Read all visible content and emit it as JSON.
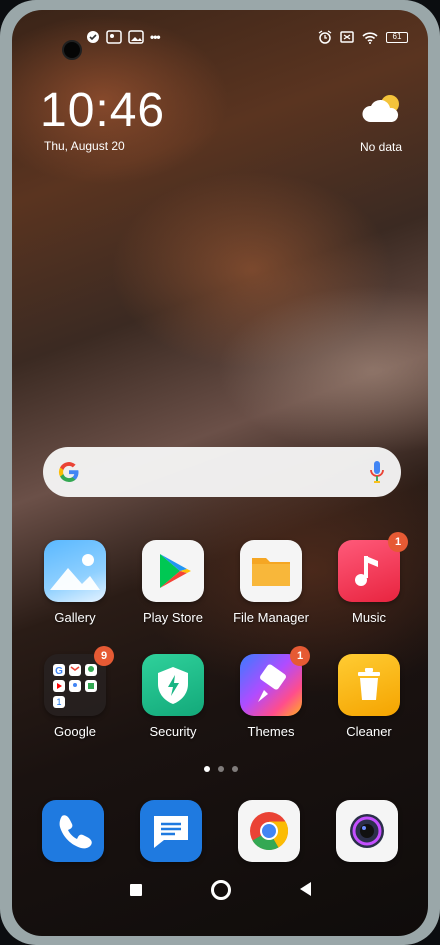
{
  "status_bar": {
    "left_icons": [
      "checkmark-shield-icon",
      "photo-icon",
      "image-icon"
    ],
    "more": "•••",
    "right_icons": [
      "alarm-icon",
      "close-box-icon",
      "wifi-icon"
    ],
    "battery": "61"
  },
  "clock": {
    "time": "10:46",
    "date": "Thu, August 20"
  },
  "weather": {
    "icon": "cloud-sun-icon",
    "text": "No data"
  },
  "search": {
    "logo": "google-g-icon",
    "mic": "mic-icon"
  },
  "apps": [
    {
      "label": "Gallery",
      "icon": "gallery-icon",
      "badge": ""
    },
    {
      "label": "Play Store",
      "icon": "play-store-icon",
      "badge": ""
    },
    {
      "label": "File Manager",
      "icon": "folder-icon",
      "badge": ""
    },
    {
      "label": "Music",
      "icon": "music-note-icon",
      "badge": "1"
    },
    {
      "label": "Google",
      "icon": "google-folder-icon",
      "badge": "9"
    },
    {
      "label": "Security",
      "icon": "security-shield-icon",
      "badge": ""
    },
    {
      "label": "Themes",
      "icon": "themes-brush-icon",
      "badge": "1"
    },
    {
      "label": "Cleaner",
      "icon": "trash-can-icon",
      "badge": ""
    }
  ],
  "dock": [
    {
      "icon": "phone-icon"
    },
    {
      "icon": "messages-icon"
    },
    {
      "icon": "chrome-icon"
    },
    {
      "icon": "camera-icon"
    }
  ],
  "page_dots": {
    "count": 3,
    "active": 0
  },
  "navbar": [
    "recents-icon",
    "home-icon",
    "back-icon"
  ]
}
